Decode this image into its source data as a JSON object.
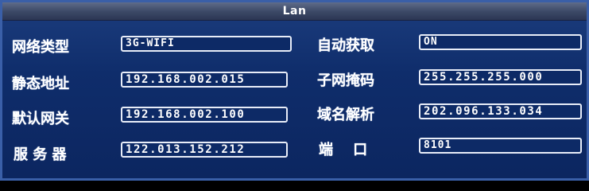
{
  "window": {
    "title": "Lan"
  },
  "left": [
    {
      "label": "网络类型",
      "value": "3G-WIFI"
    },
    {
      "label": "静态地址",
      "value": "192.168.002.015"
    },
    {
      "label": "默认网关",
      "value": "192.168.002.100"
    },
    {
      "label": "服 务 器",
      "value": "122.013.152.212"
    }
  ],
  "right": [
    {
      "label": "自动获取",
      "value": "ON"
    },
    {
      "label": "子网掩码",
      "value": "255.255.255.000"
    },
    {
      "label": "域名解析",
      "value": "202.096.133.034"
    },
    {
      "label": "端    口",
      "value": "8101"
    }
  ],
  "colors": {
    "panel_bg": "#0f2d6b",
    "field_border": "#e8edf8",
    "text": "#ffffff"
  }
}
